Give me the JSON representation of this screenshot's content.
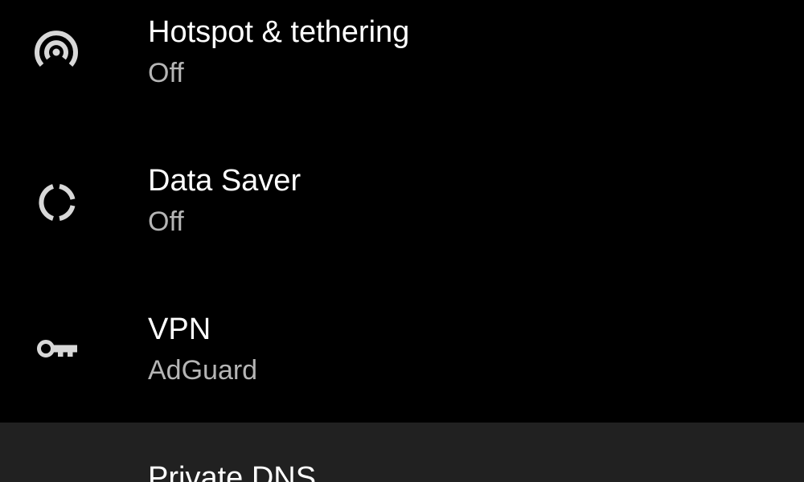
{
  "settings": {
    "items": [
      {
        "title": "Hotspot & tethering",
        "summary": "Off",
        "icon": "hotspot-icon"
      },
      {
        "title": "Data Saver",
        "summary": "Off",
        "icon": "data-saver-icon"
      },
      {
        "title": "VPN",
        "summary": "AdGuard",
        "icon": "vpn-key-icon"
      },
      {
        "title": "Private DNS",
        "icon": "private-dns-icon"
      }
    ]
  },
  "colors": {
    "background": "#000000",
    "highlight_row": "#212121",
    "title_text": "#ffffff",
    "summary_text": "#b5b5b5",
    "icon": "#d8d8d8"
  }
}
